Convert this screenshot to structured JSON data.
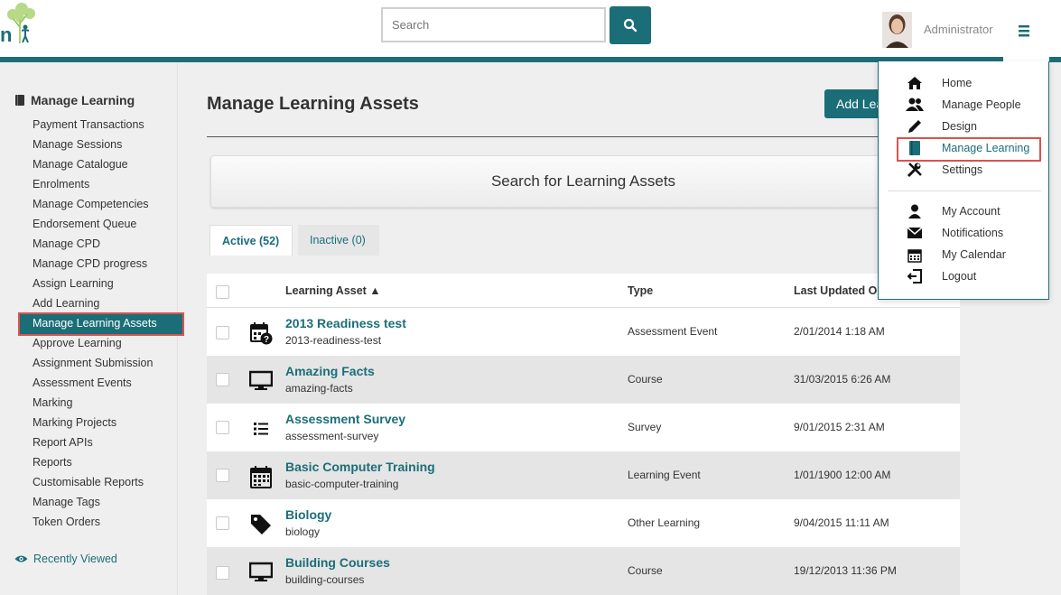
{
  "header": {
    "search_placeholder": "Search",
    "user_name": "Administrator"
  },
  "sidebar": {
    "title": "Manage Learning",
    "items": [
      "Payment Transactions",
      "Manage Sessions",
      "Manage Catalogue",
      "Enrolments",
      "Manage Competencies",
      "Endorsement Queue",
      "Manage CPD",
      "Manage CPD progress",
      "Assign Learning",
      "Add Learning",
      "Manage Learning Assets",
      "Approve Learning",
      "Assignment Submission",
      "Assessment Events",
      "Marking",
      "Marking Projects",
      "Report APIs",
      "Reports",
      "Customisable Reports",
      "Manage Tags",
      "Token Orders"
    ],
    "active_item": "Manage Learning Assets",
    "recently_viewed": "Recently Viewed"
  },
  "main": {
    "title": "Manage Learning Assets",
    "add_button": "Add Learning Asset",
    "search_panel": "Search for Learning Assets",
    "tabs": [
      {
        "label": "Active (52)",
        "active": true
      },
      {
        "label": "Inactive (0)",
        "active": false
      }
    ],
    "columns": {
      "asset": "Learning Asset ▲",
      "type": "Type",
      "updated": "Last Updated On"
    },
    "rows": [
      {
        "name": "2013 Readiness test",
        "slug": "2013-readiness-test",
        "type": "Assessment Event",
        "updated": "2/01/2014 1:18 AM",
        "icon": "calendar-question-icon"
      },
      {
        "name": "Amazing Facts",
        "slug": "amazing-facts",
        "type": "Course",
        "updated": "31/03/2015 6:26 AM",
        "icon": "monitor-icon"
      },
      {
        "name": "Assessment Survey",
        "slug": "assessment-survey",
        "type": "Survey",
        "updated": "9/01/2015 2:31 AM",
        "icon": "list-icon"
      },
      {
        "name": "Basic Computer Training",
        "slug": "basic-computer-training",
        "type": "Learning Event",
        "updated": "1/01/1900 12:00 AM",
        "icon": "calendar-icon"
      },
      {
        "name": "Biology",
        "slug": "biology",
        "type": "Other Learning",
        "updated": "9/04/2015 11:11 AM",
        "icon": "tag-icon"
      },
      {
        "name": "Building Courses",
        "slug": "building-courses",
        "type": "Course",
        "updated": "19/12/2013 11:36 PM",
        "icon": "monitor-icon"
      }
    ]
  },
  "dropdown": {
    "group1": [
      {
        "label": "Home",
        "icon": "home-icon"
      },
      {
        "label": "Manage People",
        "icon": "people-icon"
      },
      {
        "label": "Design",
        "icon": "pencil-icon"
      },
      {
        "label": "Manage Learning",
        "icon": "book-icon"
      },
      {
        "label": "Settings",
        "icon": "tools-icon"
      }
    ],
    "group2": [
      {
        "label": "My Account",
        "icon": "user-icon"
      },
      {
        "label": "Notifications",
        "icon": "envelope-icon"
      },
      {
        "label": "My Calendar",
        "icon": "calendar-icon"
      },
      {
        "label": "Logout",
        "icon": "logout-icon"
      }
    ]
  },
  "colors": {
    "accent": "#1b6e78",
    "highlight_border": "#d9534f",
    "alt_row": "#e5e5e5"
  }
}
